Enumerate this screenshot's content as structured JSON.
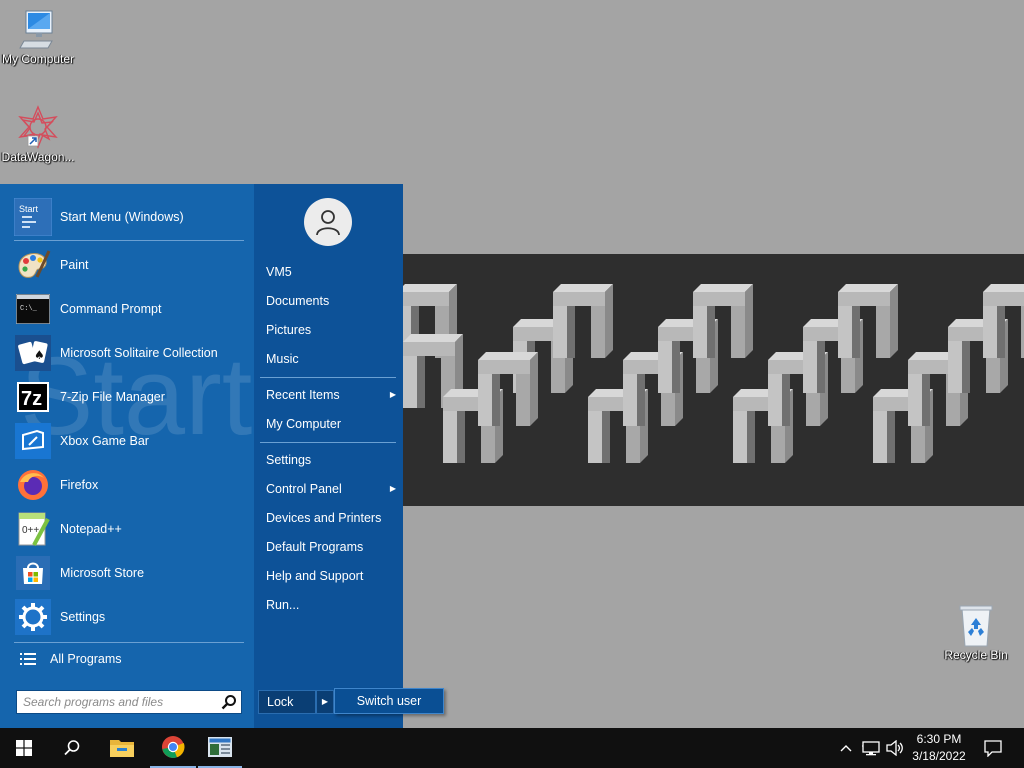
{
  "desktop": {
    "icons": [
      {
        "label": "My Computer"
      },
      {
        "label": "DataWagon..."
      },
      {
        "label": "Recycle Bin"
      }
    ]
  },
  "start_menu": {
    "header_item": {
      "label": "Start Menu (Windows)",
      "icon": "start-menu-icon"
    },
    "programs": [
      {
        "label": "Paint",
        "icon": "paint-icon"
      },
      {
        "label": "Command Prompt",
        "icon": "command-prompt-icon"
      },
      {
        "label": "Microsoft Solitaire Collection",
        "icon": "solitaire-icon"
      },
      {
        "label": "7-Zip File Manager",
        "icon": "7zip-icon"
      },
      {
        "label": "Xbox Game Bar",
        "icon": "xbox-game-bar-icon"
      },
      {
        "label": "Firefox",
        "icon": "firefox-icon"
      },
      {
        "label": "Notepad++",
        "icon": "notepad-plus-plus-icon"
      },
      {
        "label": "Microsoft Store",
        "icon": "microsoft-store-icon"
      },
      {
        "label": "Settings",
        "icon": "settings-gear-icon"
      }
    ],
    "all_programs": "All Programs",
    "search": {
      "placeholder": "Search programs and files",
      "value": ""
    },
    "right_items": {
      "user": "VM5",
      "documents": "Documents",
      "pictures": "Pictures",
      "music": "Music",
      "recent_items": "Recent Items",
      "my_computer": "My Computer",
      "settings": "Settings",
      "control_panel": "Control Panel",
      "devices_printers": "Devices and Printers",
      "default_programs": "Default Programs",
      "help_support": "Help and Support",
      "run": "Run..."
    },
    "lock": "Lock",
    "submenu_arrow": "▶",
    "switch_user": "Switch user"
  },
  "taskbar": {
    "time": "6:30 PM",
    "date": "3/18/2022",
    "pinned": [
      "windows-start-icon",
      "search-icon",
      "file-explorer-icon",
      "chrome-icon",
      "start-menu-app-icon"
    ]
  },
  "colors": {
    "start_menu_left": "#1565ad",
    "start_menu_right": "#0d5298",
    "taskbar": "#101010",
    "desktop": "#a4a4a4"
  }
}
